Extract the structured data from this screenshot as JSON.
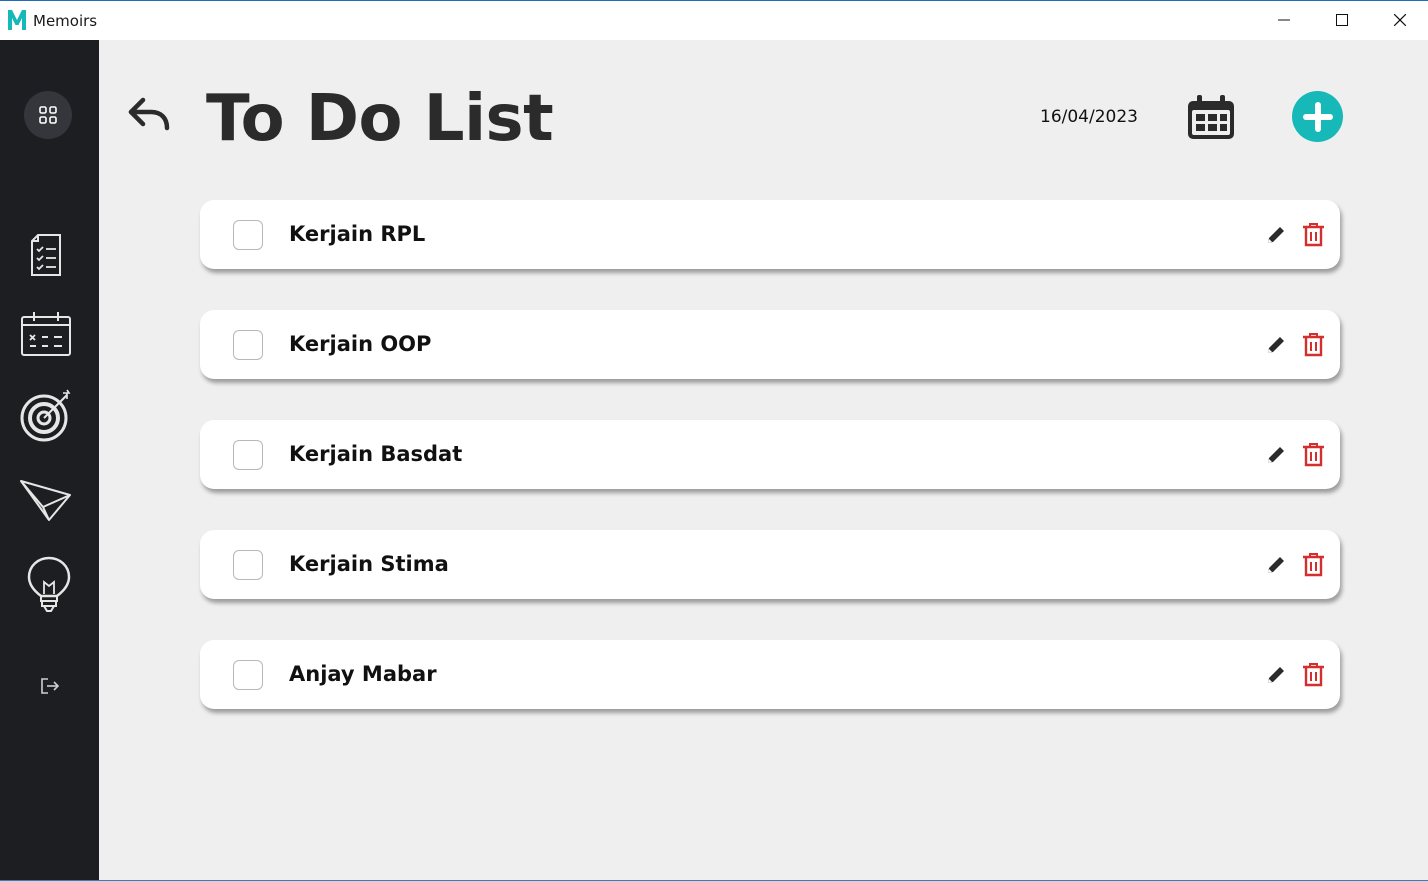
{
  "window": {
    "title": "Memoirs",
    "logo_letter": "M",
    "accent_color": "#17b8b8"
  },
  "sidebar": {
    "items": [
      {
        "icon": "grid-icon"
      },
      {
        "icon": "checklist-icon"
      },
      {
        "icon": "calendar-icon"
      },
      {
        "icon": "target-icon"
      },
      {
        "icon": "paper-plane-icon"
      },
      {
        "icon": "lightbulb-icon"
      },
      {
        "icon": "logout-icon"
      }
    ]
  },
  "header": {
    "title": "To Do List",
    "date": "16/04/2023"
  },
  "tasks": [
    {
      "label": "Kerjain RPL",
      "checked": false
    },
    {
      "label": "Kerjain OOP",
      "checked": false
    },
    {
      "label": "Kerjain Basdat",
      "checked": false
    },
    {
      "label": "Kerjain Stima",
      "checked": false
    },
    {
      "label": "Anjay Mabar",
      "checked": false
    }
  ],
  "colors": {
    "sidebar_bg": "#1d1e22",
    "delete_icon": "#d32f2f",
    "add_button": "#17b8b8"
  }
}
